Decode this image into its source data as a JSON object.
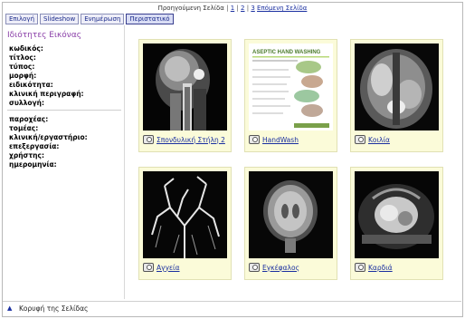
{
  "pager": {
    "prev": "Προηγούμενη Σελίδα",
    "sep": "|",
    "pages": [
      "1",
      "2",
      "3"
    ],
    "next": "Επόμενη Σελίδα"
  },
  "toolbar": {
    "buttons": [
      "Επιλογή",
      "Slideshow",
      "Ενημέρωση",
      "Περιστατικό"
    ]
  },
  "sidebar": {
    "title": "Ιδιότητες Εικόνας",
    "fields_top": [
      "κωδικός:",
      "τίτλος:",
      "τύπος:",
      "μορφή:",
      "ειδικότητα:",
      "κλινική περιγραφή:",
      "συλλογή:"
    ],
    "fields_bottom": [
      "παροχέας:",
      "τομέας:",
      "κλινική/εργαστήριο:",
      "επεξεργασία:",
      "χρήστης:",
      "ημερομηνία:"
    ]
  },
  "thumbnails": [
    {
      "label": "Σπονδυλική Στήλη 2",
      "icon": "camera-icon"
    },
    {
      "label": "HandWash",
      "icon": "camera-icon"
    },
    {
      "label": "Κοιλία",
      "icon": "camera-icon"
    },
    {
      "label": "Αγγεία",
      "icon": "camera-icon"
    },
    {
      "label": "Εγκέφαλος",
      "icon": "camera-icon"
    },
    {
      "label": "Καρδιά",
      "icon": "camera-icon"
    }
  ],
  "handwash_poster": {
    "title": "ASEPTIC HAND WASHING"
  },
  "footer": {
    "label": "Κορυφή της Σελίδας",
    "icon": "up-arrow-icon"
  },
  "colors": {
    "accent_title": "#8a3fa8",
    "link": "#1a2fa0",
    "thumb_bg": "#fbfbd9"
  }
}
